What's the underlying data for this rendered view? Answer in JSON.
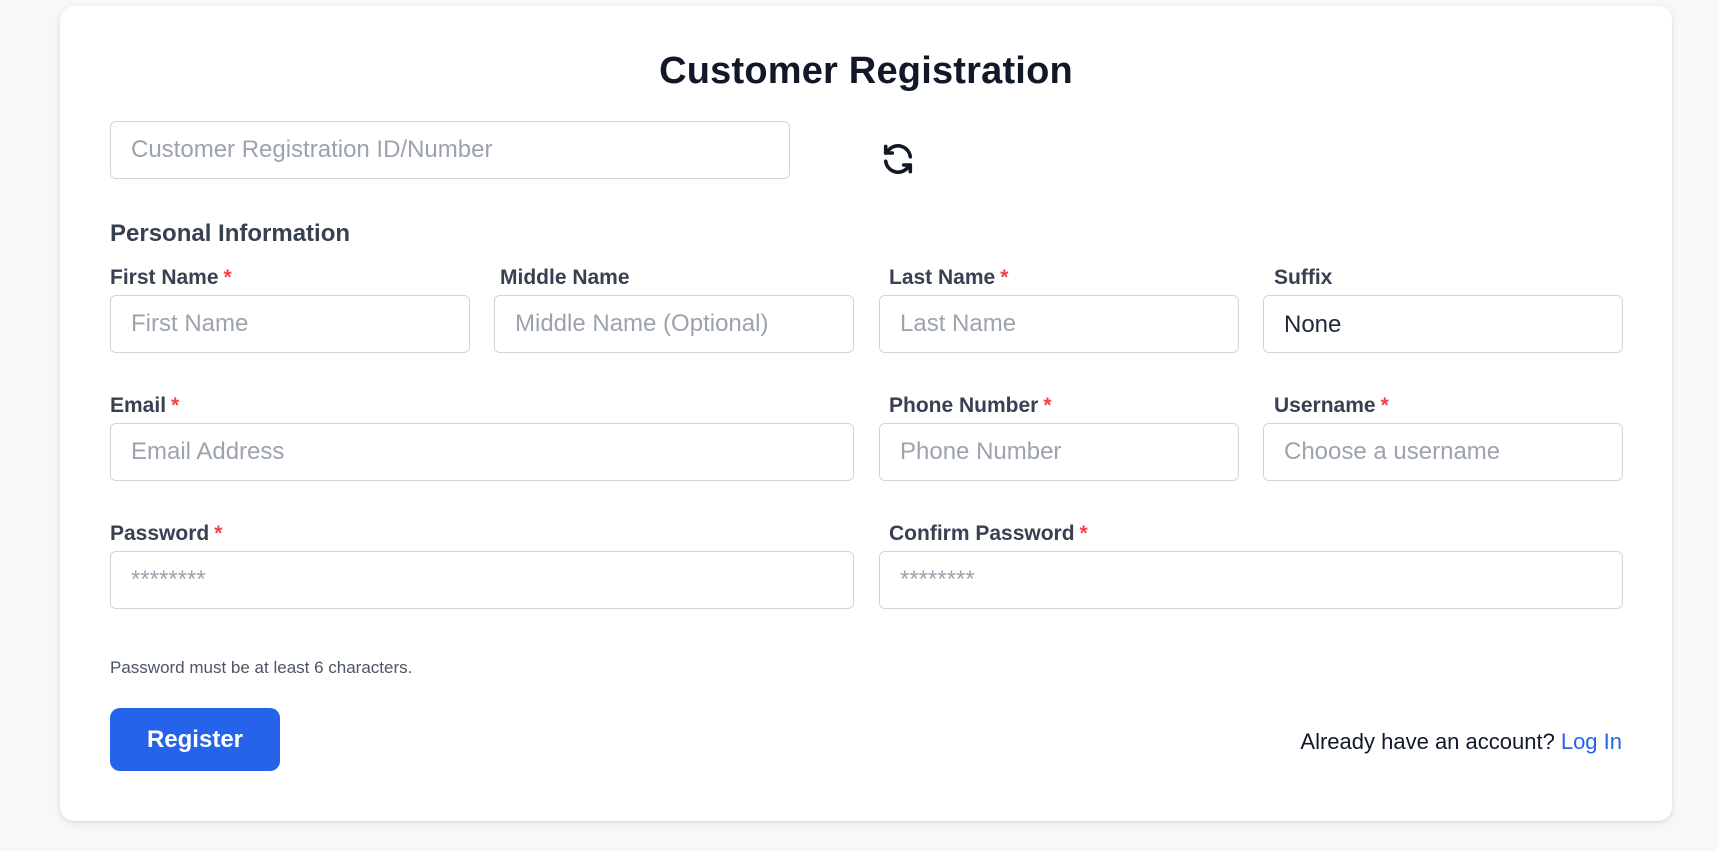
{
  "page": {
    "title": "Customer Registration"
  },
  "registration_id": {
    "placeholder": "Customer Registration ID/Number",
    "value": "",
    "refresh_icon": "refresh-icon"
  },
  "personal_info": {
    "section_title": "Personal Information",
    "required_marker": "*",
    "first_name": {
      "label": "First Name",
      "placeholder": "First Name",
      "value": ""
    },
    "middle_name": {
      "label": "Middle Name",
      "placeholder": "Middle Name (Optional)",
      "value": ""
    },
    "last_name": {
      "label": "Last Name",
      "placeholder": "Last Name",
      "value": ""
    },
    "suffix": {
      "label": "Suffix",
      "selected": "None"
    },
    "email": {
      "label": "Email",
      "placeholder": "Email Address",
      "value": ""
    },
    "phone": {
      "label": "Phone Number",
      "placeholder": "Phone Number",
      "value": ""
    },
    "username": {
      "label": "Username",
      "placeholder": "Choose a username",
      "value": ""
    },
    "password": {
      "label": "Password",
      "placeholder": "********",
      "value": ""
    },
    "confirm_password": {
      "label": "Confirm Password",
      "placeholder": "********",
      "value": ""
    },
    "password_hint": "Password must be at least 6 characters."
  },
  "actions": {
    "register_label": "Register",
    "login_prompt": "Already have an account?",
    "login_link": "Log In"
  },
  "colors": {
    "primary": "#2563eb",
    "required": "#ef4444",
    "background": "#f7f8fa",
    "card": "#ffffff",
    "border": "#d1d5db"
  }
}
